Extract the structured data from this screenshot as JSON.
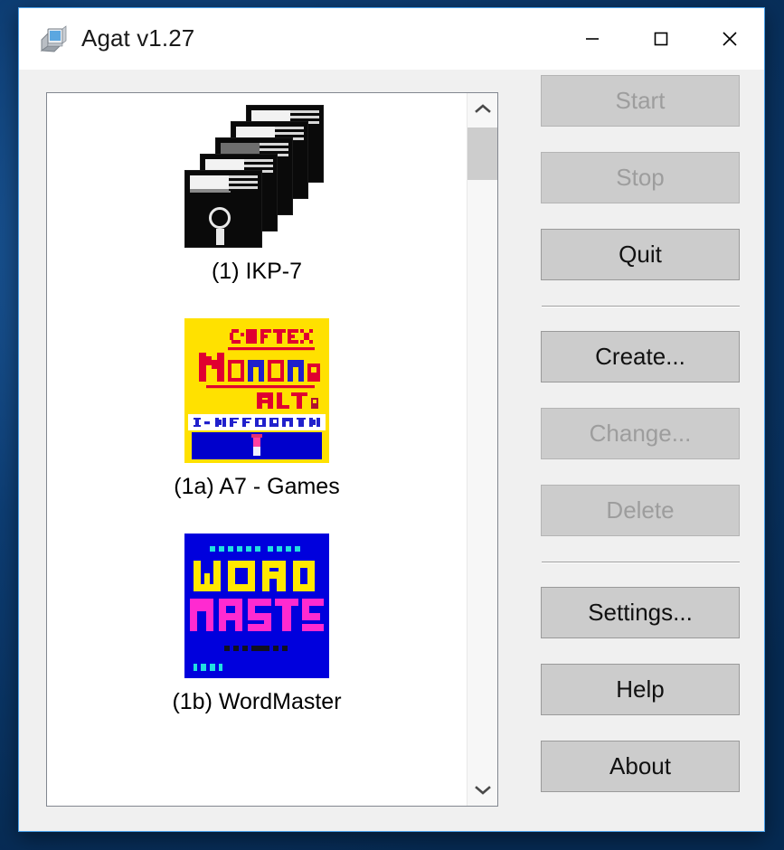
{
  "window": {
    "title": "Agat v1.27",
    "icon": "computer-icon",
    "controls": {
      "minimize": "minimize-icon",
      "maximize": "maximize-icon",
      "close": "close-icon"
    }
  },
  "list": {
    "items": [
      {
        "label": "(1) IKP-7",
        "thumb": "floppy-disk-stack",
        "selected": false
      },
      {
        "label": "(1a) A7 - Games",
        "thumb": "softex-monomania-cover",
        "selected": false
      },
      {
        "label": "(1b) WordMaster",
        "thumb": "wordmaster-cover",
        "selected": false
      }
    ],
    "scrollbar": {
      "up_arrow": "chevron-up-icon",
      "down_arrow": "chevron-down-icon",
      "thumb_position_percent": 1
    }
  },
  "buttons": [
    {
      "id": "start",
      "label": "Start",
      "enabled": false
    },
    {
      "id": "stop",
      "label": "Stop",
      "enabled": false
    },
    {
      "id": "quit",
      "label": "Quit",
      "enabled": true
    },
    {
      "id": "create",
      "label": "Create...",
      "enabled": true
    },
    {
      "id": "change",
      "label": "Change...",
      "enabled": false
    },
    {
      "id": "delete",
      "label": "Delete",
      "enabled": false
    },
    {
      "id": "settings",
      "label": "Settings...",
      "enabled": true
    },
    {
      "id": "help",
      "label": "Help",
      "enabled": true
    },
    {
      "id": "about",
      "label": "About",
      "enabled": true
    }
  ],
  "thumbnails": {
    "softex": {
      "bg": "#ffe100",
      "line1": "SOFTEX",
      "line2": "Monomania",
      "line3": "ALT author",
      "line4": "I-INFORMATION",
      "panel_color": "#0000cc"
    },
    "wordmaster": {
      "bg": "#0000dd",
      "top_line": "TEXNOLOGIA",
      "title1": "WORD",
      "title2": "MASTER",
      "version": "Version 1.0",
      "corner": "1991",
      "title1_color": "#ffe800",
      "title2_color": "#ff2ad0"
    }
  },
  "colors": {
    "window_border": "#4ba0e8",
    "face": "#f0f0f0",
    "button_face": "#cccccc",
    "disabled_text": "#9d9d9d",
    "desktop": "#0c3a6b"
  }
}
